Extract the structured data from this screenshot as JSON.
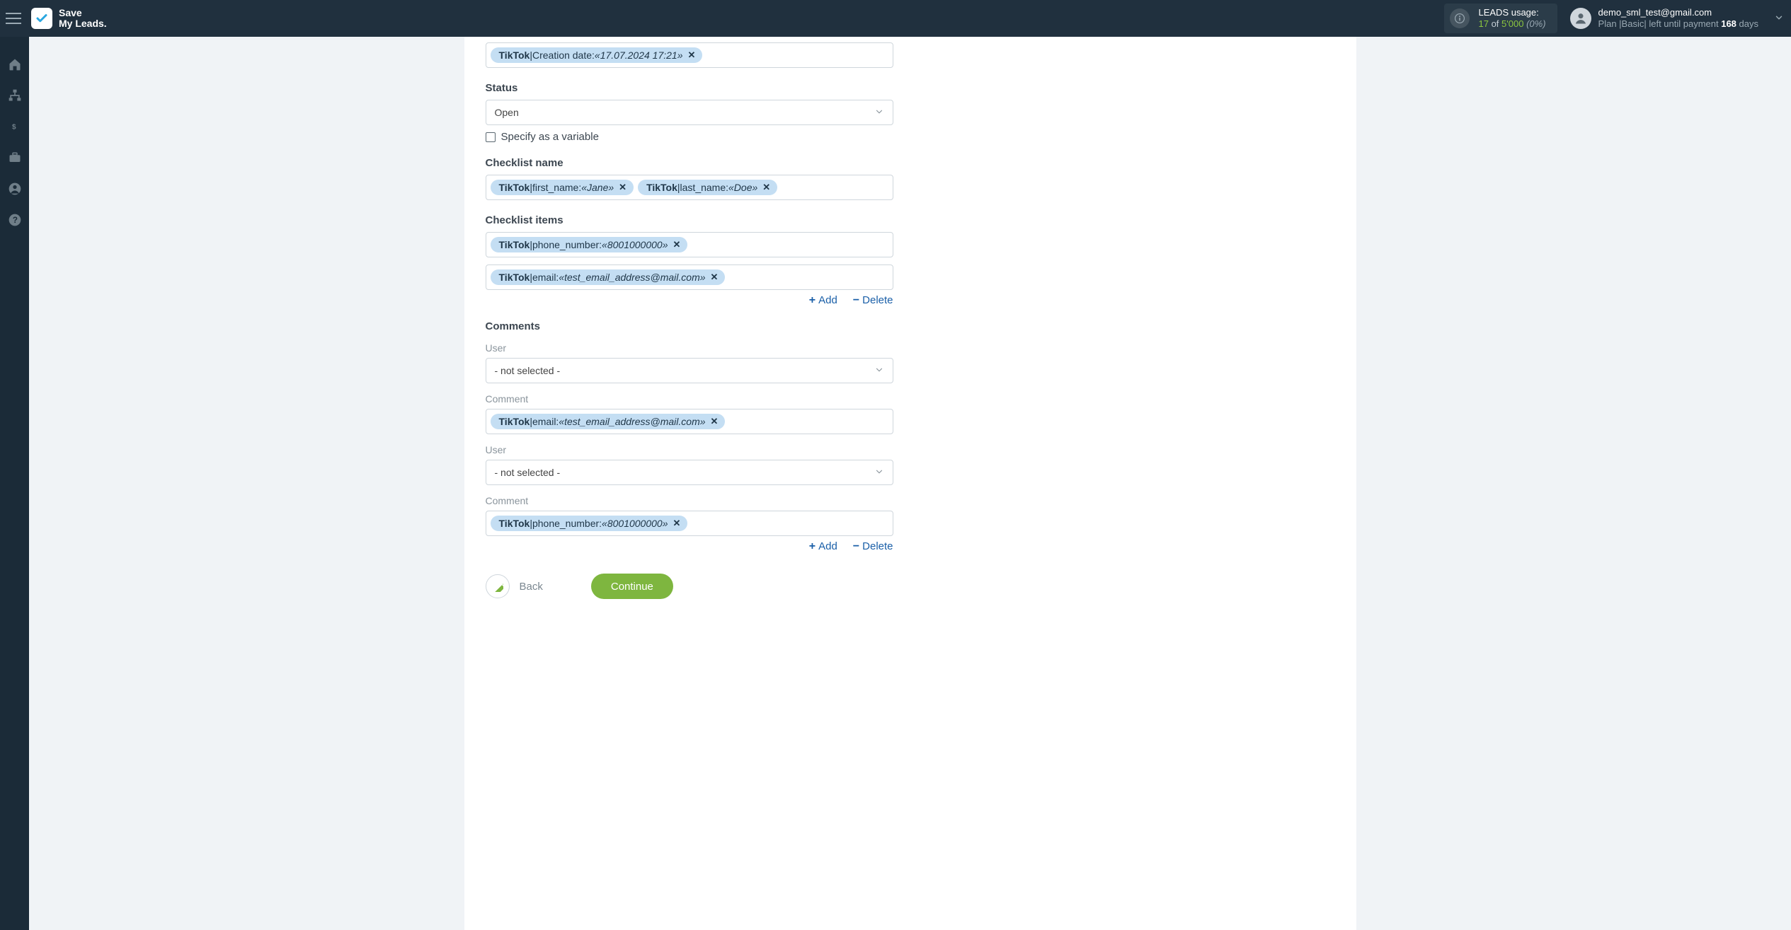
{
  "brand": {
    "line1": "Save",
    "line2": "My Leads."
  },
  "leads": {
    "label": "LEADS usage:",
    "used": "17",
    "of": "of",
    "limit": "5'000",
    "pct": "(0%)"
  },
  "user": {
    "email": "demo_sml_test@gmail.com",
    "plan_prefix": "Plan |",
    "plan_name": "Basic",
    "plan_mid": "| left until payment ",
    "days": "168",
    "plan_suffix": " days"
  },
  "form": {
    "creation": {
      "pill_source": "TikTok",
      "pill_sep": " | ",
      "pill_field": "Creation date: ",
      "pill_value": "«17.07.2024 17:21»"
    },
    "status": {
      "label": "Status",
      "value": "Open",
      "variable": "Specify as a variable"
    },
    "checklist_name": {
      "label": "Checklist name",
      "pills": [
        {
          "source": "TikTok",
          "field": "first_name: ",
          "value": "«Jane»"
        },
        {
          "source": "TikTok",
          "field": "last_name: ",
          "value": "«Doe»"
        }
      ]
    },
    "checklist_items": {
      "label": "Checklist items",
      "rows": [
        {
          "source": "TikTok",
          "field": "phone_number: ",
          "value": "«8001000000»"
        },
        {
          "source": "TikTok",
          "field": "email: ",
          "value": "«test_email_address@mail.com»"
        }
      ],
      "add": "Add",
      "delete": "Delete"
    },
    "comments": {
      "label": "Comments",
      "blocks": [
        {
          "user_label": "User",
          "user_value": "- not selected -",
          "comment_label": "Comment",
          "pill": {
            "source": "TikTok",
            "field": "email: ",
            "value": "«test_email_address@mail.com»"
          }
        },
        {
          "user_label": "User",
          "user_value": "- not selected -",
          "comment_label": "Comment",
          "pill": {
            "source": "TikTok",
            "field": "phone_number: ",
            "value": "«8001000000»"
          }
        }
      ],
      "add": "Add",
      "delete": "Delete"
    },
    "footer": {
      "back": "Back",
      "continue": "Continue"
    }
  }
}
